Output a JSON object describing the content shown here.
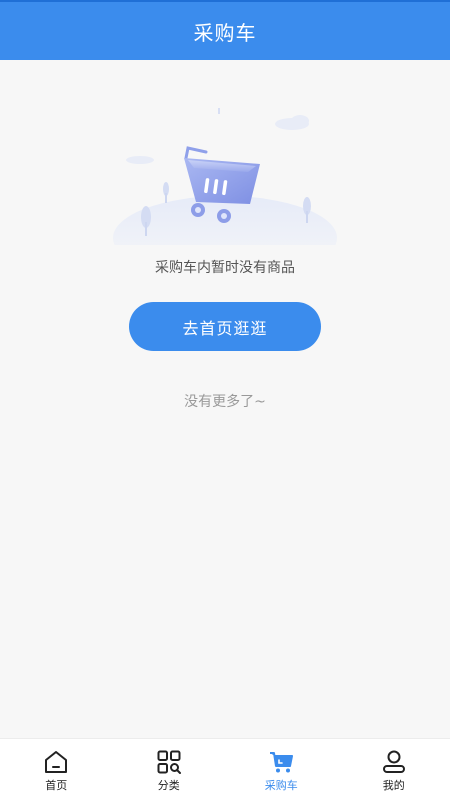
{
  "header": {
    "title": "采购车"
  },
  "empty_state": {
    "illustration": "empty-cart-illustration",
    "message": "采购车内暂时没有商品",
    "button_label": "去首页逛逛"
  },
  "footer_hint": "没有更多了~",
  "tabbar": {
    "items": [
      {
        "label": "首页",
        "icon": "home-icon",
        "active": false
      },
      {
        "label": "分类",
        "icon": "category-icon",
        "active": false
      },
      {
        "label": "采购车",
        "icon": "cart-icon",
        "active": true
      },
      {
        "label": "我的",
        "icon": "profile-icon",
        "active": false
      }
    ]
  },
  "colors": {
    "accent": "#3b8ced",
    "background": "#f7f7f7",
    "inactive_tab": "#222222"
  }
}
